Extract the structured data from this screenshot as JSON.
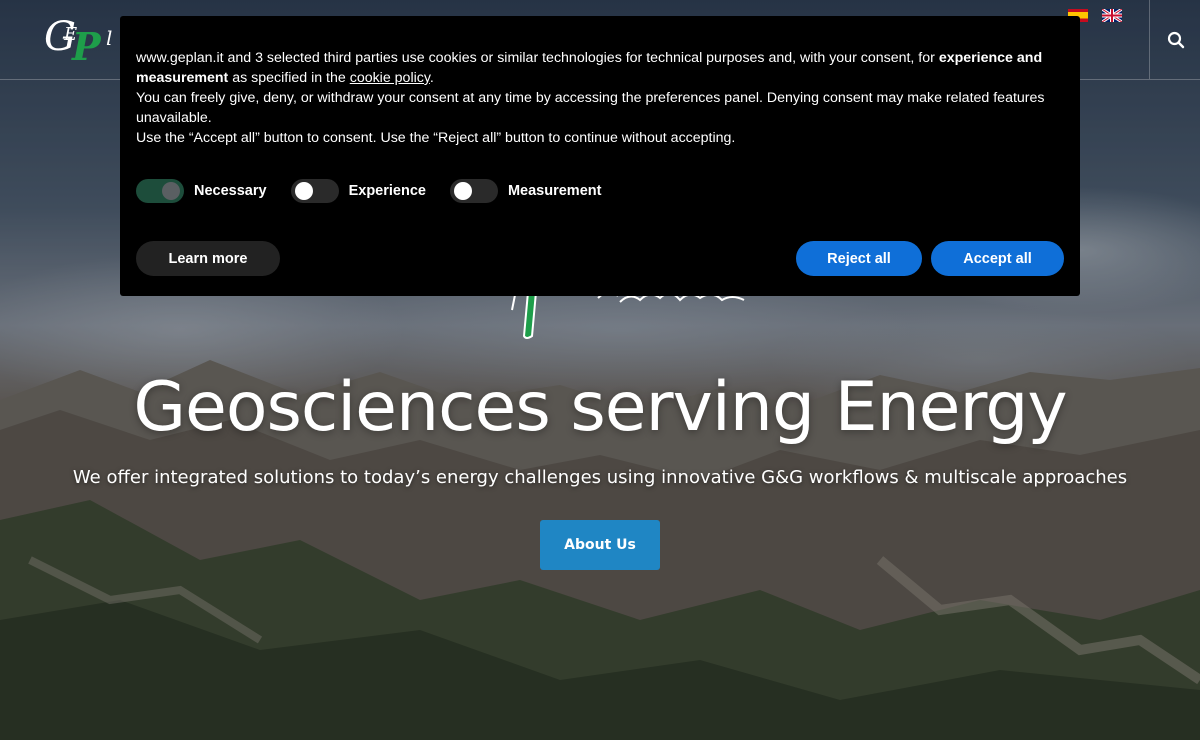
{
  "header": {
    "logo_alt": "GEPlan Consulting",
    "flags": [
      "es-flag-icon",
      "uk-flag-icon"
    ],
    "search_icon": "search-icon"
  },
  "hero": {
    "title": "Geosciences serving Energy",
    "subtitle": "We offer integrated solutions to today’s energy challenges using innovative G&G workflows & multiscale approaches",
    "button_label": "About Us"
  },
  "cookie_banner": {
    "line1_a": "www.geplan.it and 3 selected third parties use cookies or similar technologies for technical purposes and, with your consent, for ",
    "line1_bold": "experience and measurement",
    "line1_b": " as specified in the ",
    "policy_link": "cookie policy",
    "line1_end": ".",
    "line2": "You can freely give, deny, or withdraw your consent at any time by accessing the preferences panel. Denying consent may make related features unavailable.",
    "line3": "Use the “Accept all” button to consent. Use the “Reject all” button to continue without accepting.",
    "toggles": [
      {
        "label": "Necessary",
        "on": true
      },
      {
        "label": "Experience",
        "on": false
      },
      {
        "label": "Measurement",
        "on": false
      }
    ],
    "learn_more": "Learn more",
    "reject_all": "Reject all",
    "accept_all": "Accept all"
  },
  "colors": {
    "accent_blue": "#0f6fd8",
    "about_button": "#1f86c4",
    "toggle_on": "#1d4d3b",
    "logo_green": "#1e9e4a"
  }
}
